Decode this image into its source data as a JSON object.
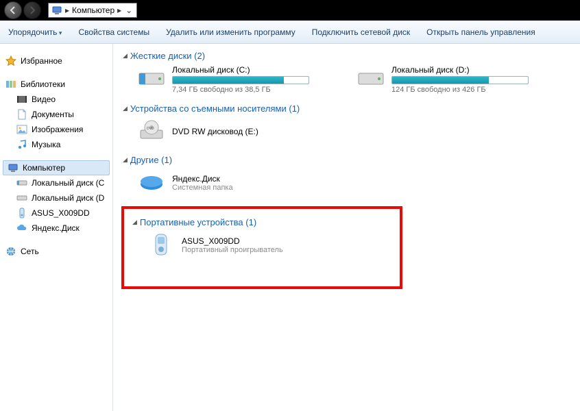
{
  "titlebar": {
    "breadcrumb_root": "Компьютер",
    "breadcrumb_sep": "▸"
  },
  "toolbar": {
    "organize": "Упорядочить",
    "sysprops": "Свойства системы",
    "uninstall": "Удалить или изменить программу",
    "mapdrive": "Подключить сетевой диск",
    "controlpanel": "Открыть панель управления"
  },
  "sidebar": {
    "favorites": "Избранное",
    "libraries": "Библиотеки",
    "lib_items": {
      "video": "Видео",
      "docs": "Документы",
      "images": "Изображения",
      "music": "Музыка"
    },
    "computer": "Компьютер",
    "comp_items": {
      "c": "Локальный диск (C",
      "d": "Локальный диск (D",
      "asus": "ASUS_X009DD",
      "yandex": "Яндекс.Диск"
    },
    "network": "Сеть"
  },
  "sections": {
    "hdd": {
      "title": "Жесткие диски (2)"
    },
    "removable": {
      "title": "Устройства со съемными носителями (1)"
    },
    "other": {
      "title": "Другие (1)"
    },
    "portable": {
      "title": "Портативные устройства (1)"
    }
  },
  "drives": {
    "c": {
      "label": "Локальный диск (C:)",
      "sub": "7,34 ГБ свободно из 38,5 ГБ",
      "fillpct": 82
    },
    "d": {
      "label": "Локальный диск (D:)",
      "sub": "124 ГБ свободно из 426 ГБ",
      "fillpct": 71
    }
  },
  "dvd": {
    "label": "DVD RW дисковод (E:)"
  },
  "yandex": {
    "label": "Яндекс.Диск",
    "sub": "Системная папка"
  },
  "asus": {
    "label": "ASUS_X009DD",
    "sub": "Портативный проигрыватель"
  }
}
